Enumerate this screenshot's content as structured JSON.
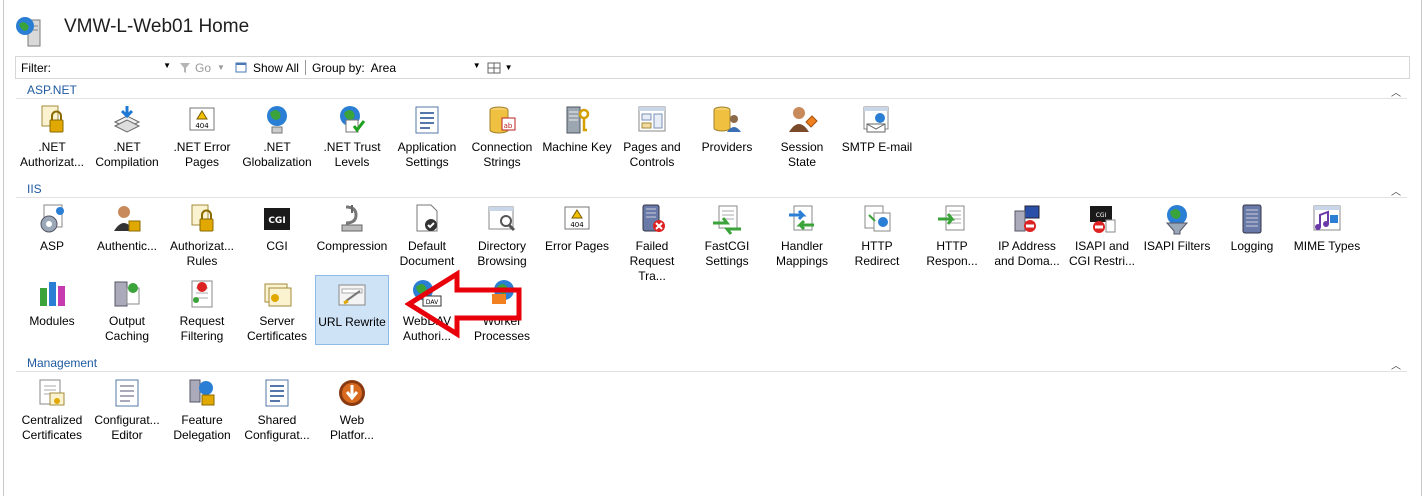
{
  "window": {
    "title": "VMW-L-Web01 Home"
  },
  "toolbar": {
    "filter_label": "Filter:",
    "go_label": "Go",
    "show_all_label": "Show All",
    "group_by_label": "Group by:",
    "group_by_value": "Area"
  },
  "sections": {
    "aspnet": {
      "title": "ASP.NET",
      "items": [
        {
          "l1": ".NET",
          "l2": "Authorizat...",
          "icon": "lock-document-icon"
        },
        {
          "l1": ".NET",
          "l2": "Compilation",
          "icon": "compile-stack-icon"
        },
        {
          "l1": ".NET Error",
          "l2": "Pages",
          "icon": "error-404-icon"
        },
        {
          "l1": ".NET",
          "l2": "Globalization",
          "icon": "globe-icon"
        },
        {
          "l1": ".NET Trust",
          "l2": "Levels",
          "icon": "trust-check-icon"
        },
        {
          "l1": "Application",
          "l2": "Settings",
          "icon": "settings-list-icon"
        },
        {
          "l1": "Connection",
          "l2": "Strings",
          "icon": "database-icon"
        },
        {
          "l1": "Machine Key",
          "l2": "",
          "icon": "machine-key-icon"
        },
        {
          "l1": "Pages and",
          "l2": "Controls",
          "icon": "pages-controls-icon"
        },
        {
          "l1": "Providers",
          "l2": "",
          "icon": "providers-icon"
        },
        {
          "l1": "Session State",
          "l2": "",
          "icon": "session-user-icon"
        },
        {
          "l1": "SMTP E-mail",
          "l2": "",
          "icon": "email-icon"
        }
      ]
    },
    "iis": {
      "title": "IIS",
      "items": [
        {
          "l1": "ASP",
          "l2": "",
          "icon": "asp-gear-icon"
        },
        {
          "l1": "Authentic...",
          "l2": "",
          "icon": "user-lock-icon"
        },
        {
          "l1": "Authorizat...",
          "l2": "Rules",
          "icon": "lock-document-icon"
        },
        {
          "l1": "CGI",
          "l2": "",
          "icon": "cgi-icon"
        },
        {
          "l1": "Compression",
          "l2": "",
          "icon": "compression-icon"
        },
        {
          "l1": "Default",
          "l2": "Document",
          "icon": "default-document-icon"
        },
        {
          "l1": "Directory",
          "l2": "Browsing",
          "icon": "directory-browse-icon"
        },
        {
          "l1": "Error Pages",
          "l2": "",
          "icon": "error-404-icon"
        },
        {
          "l1": "Failed",
          "l2": "Request Tra...",
          "icon": "failed-request-icon"
        },
        {
          "l1": "FastCGI",
          "l2": "Settings",
          "icon": "fastcgi-icon"
        },
        {
          "l1": "Handler",
          "l2": "Mappings",
          "icon": "handler-mappings-icon"
        },
        {
          "l1": "HTTP",
          "l2": "Redirect",
          "icon": "redirect-icon"
        },
        {
          "l1": "HTTP",
          "l2": "Respon...",
          "icon": "http-response-icon"
        },
        {
          "l1": "IP Address",
          "l2": "and Doma...",
          "icon": "ip-restrict-icon"
        },
        {
          "l1": "ISAPI and",
          "l2": "CGI Restri...",
          "icon": "isapi-restrict-icon"
        },
        {
          "l1": "ISAPI Filters",
          "l2": "",
          "icon": "isapi-filter-icon"
        },
        {
          "l1": "Logging",
          "l2": "",
          "icon": "logging-icon"
        },
        {
          "l1": "MIME Types",
          "l2": "",
          "icon": "mime-icon"
        },
        {
          "l1": "Modules",
          "l2": "",
          "icon": "modules-icon"
        },
        {
          "l1": "Output",
          "l2": "Caching",
          "icon": "output-cache-icon"
        },
        {
          "l1": "Request",
          "l2": "Filtering",
          "icon": "request-filter-icon"
        },
        {
          "l1": "Server",
          "l2": "Certificates",
          "icon": "certificates-icon"
        },
        {
          "l1": "URL Rewrite",
          "l2": "",
          "icon": "url-rewrite-icon"
        },
        {
          "l1": "WebDAV",
          "l2": "Authori...",
          "icon": "webdav-icon"
        },
        {
          "l1": "Worker",
          "l2": "Processes",
          "icon": "worker-process-icon"
        }
      ]
    },
    "management": {
      "title": "Management",
      "items": [
        {
          "l1": "Centralized",
          "l2": "Certificates",
          "icon": "centralized-cert-icon"
        },
        {
          "l1": "Configurat...",
          "l2": "Editor",
          "icon": "config-editor-icon"
        },
        {
          "l1": "Feature",
          "l2": "Delegation",
          "icon": "feature-delegation-icon"
        },
        {
          "l1": "Shared",
          "l2": "Configurat...",
          "icon": "shared-config-icon"
        },
        {
          "l1": "Web",
          "l2": "Platfor...",
          "icon": "web-platform-icon"
        }
      ]
    }
  },
  "colors": {
    "section": "#1f5aa0",
    "selection": "#cfe3f7",
    "arrow": "#e8000b"
  }
}
